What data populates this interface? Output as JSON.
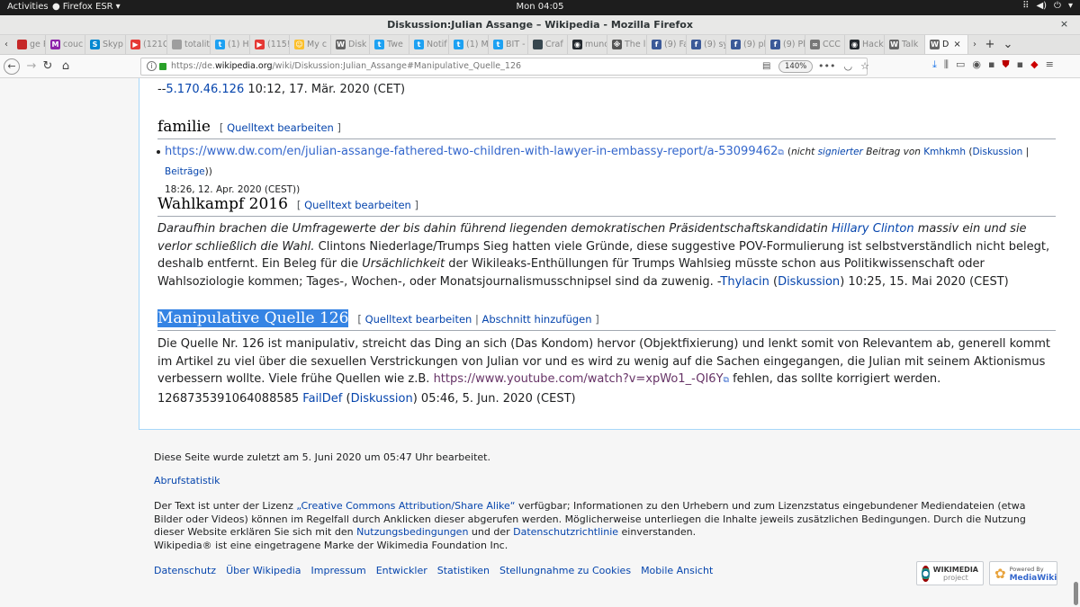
{
  "topbar": {
    "activities": "Activities",
    "app": "Firefox ESR",
    "clock": "Mon 04:05"
  },
  "window": {
    "title": "Diskussion:Julian Assange – Wikipedia - Mozilla Firefox"
  },
  "tabs": [
    {
      "label": "ge Red",
      "color": "#c62828",
      "glyph": ""
    },
    {
      "label": "couc",
      "color": "#8e24aa",
      "glyph": "M"
    },
    {
      "label": "Skyp",
      "color": "#0288d1",
      "glyph": "S"
    },
    {
      "label": "(121C",
      "color": "#e53935",
      "glyph": "▶"
    },
    {
      "label": "totalitär",
      "color": "#9e9e9e",
      "glyph": ""
    },
    {
      "label": "(1) Ha",
      "color": "#1da1f2",
      "glyph": "t"
    },
    {
      "label": "(115!",
      "color": "#e53935",
      "glyph": "▶"
    },
    {
      "label": "My c",
      "color": "#fbc02d",
      "glyph": "☺"
    },
    {
      "label": "Disk",
      "color": "#666666",
      "glyph": "W"
    },
    {
      "label": "Twe",
      "color": "#1da1f2",
      "glyph": "t"
    },
    {
      "label": "Notif",
      "color": "#1da1f2",
      "glyph": "t"
    },
    {
      "label": "(1) M",
      "color": "#1da1f2",
      "glyph": "t"
    },
    {
      "label": "BIT -",
      "color": "#1da1f2",
      "glyph": "t"
    },
    {
      "label": "Craf",
      "color": "#37474f",
      "glyph": ""
    },
    {
      "label": "munc",
      "color": "#24292e",
      "glyph": "◉"
    },
    {
      "label": "The l",
      "color": "#555555",
      "glyph": "※"
    },
    {
      "label": "(9) Fa",
      "color": "#3b5998",
      "glyph": "f"
    },
    {
      "label": "(9) sy",
      "color": "#3b5998",
      "glyph": "f"
    },
    {
      "label": "(9) pl",
      "color": "#3b5998",
      "glyph": "f"
    },
    {
      "label": "(9) Pl",
      "color": "#3b5998",
      "glyph": "f"
    },
    {
      "label": "CCC",
      "color": "#777777",
      "glyph": "∞"
    },
    {
      "label": "Hack",
      "color": "#24292e",
      "glyph": "◉"
    },
    {
      "label": "Talk",
      "color": "#666666",
      "glyph": "W"
    },
    {
      "label": "D",
      "color": "#666666",
      "glyph": "W",
      "active": true
    }
  ],
  "tab_close": "×",
  "navbar": {
    "url_prefix": "https://de.",
    "url_domain": "wikipedia.org",
    "url_path": "/wiki/Diskussion:Julian_Assange#Manipulative_Quelle_126",
    "zoom": "140%"
  },
  "article": {
    "prev_sig": {
      "prefix": "--",
      "ip": "5.170.46.126",
      "date": " 10:12, 17. Mär. 2020 (CET)"
    },
    "edit_open": "[",
    "edit_close": "]",
    "edit_label": "Quelltext bearbeiten",
    "sections": {
      "familie": {
        "title": "familie",
        "link": "https://www.dw.com/en/julian-assange-fathered-two-children-with-lawyer-in-embassy-report/a-53099462",
        "ext_icon": "⧉",
        "sig_open": "(",
        "sig_nicht": "nicht",
        "sig_signierter": "signierter",
        "sig_beitrag": "Beitrag von",
        "user": "Kmhkmh",
        "diskussion": "Diskussion",
        "sep": "|",
        "beitraege": "Beiträge",
        "sig_close": ")",
        "date": "18:26, 12. Apr. 2020 (CEST))"
      },
      "wahlkampf": {
        "title": "Wahlkampf 2016",
        "quote1": "Daraufhin brachen die Umfragewerte der bis dahin führend liegenden demokratischen Präsidentschaftskandidatin",
        "hillary": "Hillary Clinton",
        "quote2": "massiv ein und sie verlor schließlich die Wahl.",
        "text1": "Clintons Niederlage/Trumps Sieg hatten viele Gründe, diese suggestive POV-Formulierung ist selbstverständlich nicht belegt, deshalb entfernt. Ein Beleg für die",
        "ursaechlich": "Ursächlichkeit",
        "text2": "der Wikileaks-Enthüllungen für Trumps Wahlsieg müsste schon aus Politikwissenschaft oder Wahlsoziologie kommen; Tages-, Wochen-, oder Monatsjournalismusschnipsel sind da zuwenig. -",
        "user": "Thylacin",
        "diskussion": "Diskussion",
        "date": "10:25, 15. Mai 2020 (CEST)"
      },
      "manipulative": {
        "title": "Manipulative Quelle 126",
        "add_section": "Abschnitt hinzufügen",
        "text1": "Die Quelle Nr. 126 ist manipulativ, streicht das Ding an sich (Das Kondom) hervor (Objektfixierung) und lenkt somit von Relevantem ab, generell kommt im Artikel zu viel über die sexuellen Verstrickungen von Julian vor und es wird zu wenig auf die Sachen eingegangen, die Julian mit seinem Aktionismus verbessern wollte. Viele frühe Quellen wie z.B.",
        "yt": "https://www.youtube.com/watch?v=xpWo1_-QI6Y",
        "text2": "fehlen, das sollte korrigiert werden. 1268735391064088585",
        "user": "FailDef",
        "diskussion": "Diskussion",
        "date": "05:46, 5. Jun. 2020 (CEST)"
      }
    }
  },
  "footer": {
    "last_edit": "Diese Seite wurde zuletzt am 5. Juni 2020 um 05:47 Uhr bearbeitet.",
    "stats": "Abrufstatistik",
    "license1": "Der Text ist unter der Lizenz",
    "license_link": "„Creative Commons Attribution/Share Alike“",
    "license2": "verfügbar; Informationen zu den Urhebern und zum Lizenzstatus eingebundener Mediendateien (etwa Bilder oder Videos) können im Regelfall durch Anklicken dieser abgerufen werden. Möglicherweise unterliegen die Inhalte jeweils zusätzlichen Bedingungen. Durch die Nutzung dieser Website erklären Sie sich mit den",
    "nutzung": "Nutzungsbedingungen",
    "und": "und der",
    "datenschutzrl": "Datenschutzrichtlinie",
    "einverstanden": "einverstanden.",
    "trademark": "Wikipedia® ist eine eingetragene Marke der Wikimedia Foundation Inc.",
    "links": [
      "Datenschutz",
      "Über Wikipedia",
      "Impressum",
      "Entwickler",
      "Statistiken",
      "Stellungnahme zu Cookies",
      "Mobile Ansicht"
    ],
    "wm_badge1": "WIKIMEDIA",
    "wm_badge2": "project",
    "mw_badge1": "Powered By",
    "mw_badge2": "MediaWiki"
  }
}
